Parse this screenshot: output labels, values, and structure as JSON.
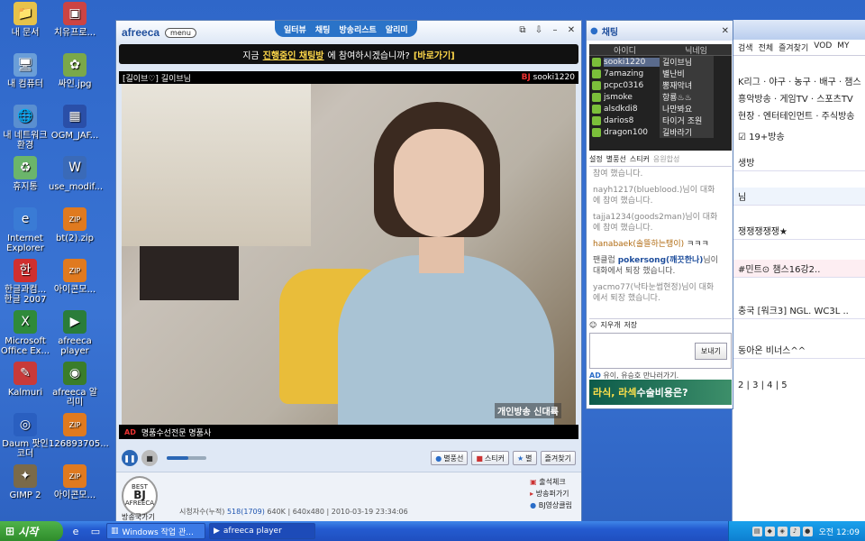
{
  "desktop": {
    "icons": [
      {
        "label": "내 문서",
        "glyph": "📁",
        "color": "#e6c24a"
      },
      {
        "label": "치유프로...",
        "glyph": "▣",
        "color": "#c44"
      },
      {
        "label": "내 컴퓨터",
        "glyph": "🖥",
        "color": "#6a9ed8"
      },
      {
        "label": "싸인.jpg",
        "glyph": "✿",
        "color": "#7aa84a"
      },
      {
        "label": "내 네트워크 환경",
        "glyph": "🌐",
        "color": "#5a8fd0"
      },
      {
        "label": "OGM_JAF...",
        "glyph": "▦",
        "color": "#2a4fa8"
      },
      {
        "label": "휴지통",
        "glyph": "♻",
        "color": "#6bb56b"
      },
      {
        "label": "use_modif...",
        "glyph": "W",
        "color": "#3a6ab8"
      },
      {
        "label": "Internet Explorer",
        "glyph": "e",
        "color": "#3a7bd5"
      },
      {
        "label": "bt(2).zip",
        "glyph": "ZIP",
        "color": "#e07a1f"
      },
      {
        "label": "한글과컴... 한글 2007",
        "glyph": "한",
        "color": "#d03030"
      },
      {
        "label": "아이콘모...",
        "glyph": "ZIP",
        "color": "#e07a1f"
      },
      {
        "label": "Microsoft Office Ex...",
        "glyph": "X",
        "color": "#2f8a3a"
      },
      {
        "label": "afreeca player",
        "glyph": "▶",
        "color": "#2a7d3a"
      },
      {
        "label": "Kalmuri",
        "glyph": "✎",
        "color": "#c83a3a"
      },
      {
        "label": "afreeca 알리미",
        "glyph": "◉",
        "color": "#3a7d2a"
      },
      {
        "label": "Daum 팟인코더",
        "glyph": "◎",
        "color": "#2a5fc0"
      },
      {
        "label": "126893705...",
        "glyph": "ZIP",
        "color": "#e07a1f"
      },
      {
        "label": "GIMP 2",
        "glyph": "✦",
        "color": "#7a6a4a"
      },
      {
        "label": "아이콘모...",
        "glyph": "ZIP",
        "color": "#e07a1f"
      }
    ]
  },
  "player": {
    "logo": "afreeca",
    "menu_label": "menu",
    "nav": [
      "일터뷰",
      "채팅",
      "방송리스트",
      "알리미"
    ],
    "notice": {
      "prefix": "지금",
      "highlight": "진행중인 채팅방",
      "suffix": "에 참여하시겠습니까?",
      "action": "[바로가기]"
    },
    "video_header": {
      "title": "[길이브♡] 길이브님",
      "bj_tag": "BJ",
      "bj_id": "sooki1220"
    },
    "video_tag": "개인방송 신대륙",
    "ad_tag": "AD",
    "ad_text": "명품수선전문 명품사",
    "buttons": {
      "balloon": "별풍선",
      "sticker": "스티커",
      "star": "별",
      "favorite": "즐겨찾기"
    },
    "volume": 0.55,
    "badge": {
      "top": "BEST",
      "main": "BJ",
      "sub": "AFREECA"
    },
    "badge_link": "방송국가기",
    "stats": {
      "label": "시청자수(누적)",
      "viewers": "518",
      "cumulative": "(1709)",
      "bitrate": "640K",
      "resolution": "640x480",
      "datetime": "2010-03-19 23:34:06"
    },
    "side_links": [
      "출석체크",
      "방송퍼가기",
      "BJ영상클립"
    ]
  },
  "chat": {
    "title": "채팅",
    "columns": {
      "id": "아이디",
      "nick": "닉네임"
    },
    "users": [
      {
        "id": "sooki1220",
        "nick": "길이브님"
      },
      {
        "id": "7amazing",
        "nick": "별난비"
      },
      {
        "id": "pcpc0316",
        "nick": "뽕재악녀"
      },
      {
        "id": "jsmoke",
        "nick": "항룡♨♨"
      },
      {
        "id": "alsdkdi8",
        "nick": "나만봐요"
      },
      {
        "id": "darios8",
        "nick": "타이거 조원"
      },
      {
        "id": "dragon100",
        "nick": "길바라기"
      }
    ],
    "tools": {
      "setting": "설정",
      "balloon": "별풍선",
      "sticker": "스티커",
      "support": "응원합성"
    },
    "messages": [
      {
        "type": "sys",
        "text": "참여 했습니다."
      },
      {
        "type": "sys",
        "text": "nayh1217(blueblood.)님이 대화에 참여 했습니다."
      },
      {
        "type": "sys",
        "text": "tajja1234(goods2man)님이 대화에 참여 했습니다."
      },
      {
        "type": "chat",
        "name": "hanabaek(솔뜰하는탱이)",
        "text": "ㅋㅋㅋ"
      },
      {
        "type": "fan",
        "prefix": "팬클럽",
        "name": "pokersong(깨끗한나)",
        "text": "님이 대화에서 퇴장 했습니다."
      },
      {
        "type": "sys",
        "text": "yacmo77(낙타눈썹현정)님이 대화에서 퇴장 했습니다."
      }
    ],
    "input_tools": {
      "clear": "지우개",
      "save": "저장"
    },
    "send_label": "보내기",
    "ad_line_tag": "AD",
    "ad_line": "유이, 유승호 만나러가기.",
    "ad_banner_a": "라식, 라섹",
    "ad_banner_b": " 수술비용은?"
  },
  "background_window": {
    "tabs": [
      "검색",
      "전체",
      "즐겨찾기",
      "VOD",
      "MY"
    ],
    "cats": "K리그 · 야구 · 농구 · 배구 · 챔스",
    "cats2": "흥악방송 · 게임TV · 스포츠TV",
    "cats3": "현장 · 엔터테인먼트 · 주식방송",
    "filter": "19+방송",
    "rows": [
      "생방",
      "님",
      "쟁쟁쟁쟁쟁★",
      "#민트⊙ 챔스16강2..",
      "충국 [워크3] NGL. WC3L ..",
      "동아온 비너스^^"
    ],
    "pager": "2 | 3 | 4 | 5"
  },
  "taskbar": {
    "start": "시작",
    "tasks": [
      "Windows 작업 관...",
      "afreeca player"
    ],
    "clock": "오전 12:09"
  }
}
